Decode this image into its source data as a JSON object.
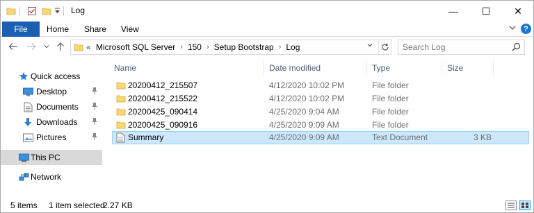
{
  "window": {
    "title": "Log",
    "controls": {
      "minimize": "—",
      "maximize": "☐",
      "close": "✕"
    }
  },
  "ribbon": {
    "tabs": [
      {
        "label": "File"
      },
      {
        "label": "Home"
      },
      {
        "label": "Share"
      },
      {
        "label": "View"
      }
    ]
  },
  "address": {
    "prefix": "«",
    "crumbs": [
      "Microsoft SQL Server",
      "150",
      "Setup Bootstrap",
      "Log"
    ]
  },
  "search": {
    "placeholder": "Search Log"
  },
  "sidebar": {
    "items": [
      {
        "label": "Quick access",
        "icon": "star-icon",
        "pinned": false
      },
      {
        "label": "Desktop",
        "icon": "desktop-icon",
        "pinned": true
      },
      {
        "label": "Documents",
        "icon": "documents-icon",
        "pinned": true
      },
      {
        "label": "Downloads",
        "icon": "download-icon",
        "pinned": true
      },
      {
        "label": "Pictures",
        "icon": "pictures-icon",
        "pinned": true
      },
      {
        "label": "This PC",
        "icon": "computer-icon",
        "pinned": false,
        "selected": true
      },
      {
        "label": "Network",
        "icon": "network-icon",
        "pinned": false
      }
    ]
  },
  "table": {
    "columns": [
      "Name",
      "Date modified",
      "Type",
      "Size"
    ],
    "rows": [
      {
        "name": "20200412_215507",
        "date": "4/12/2020 10:02 PM",
        "type": "File folder",
        "size": "",
        "icon": "folder-icon"
      },
      {
        "name": "20200412_215522",
        "date": "4/12/2020 10:02 PM",
        "type": "File folder",
        "size": "",
        "icon": "folder-icon"
      },
      {
        "name": "20200425_090414",
        "date": "4/25/2020 9:04 AM",
        "type": "File folder",
        "size": "",
        "icon": "folder-icon"
      },
      {
        "name": "20200425_090916",
        "date": "4/25/2020 9:09 AM",
        "type": "File folder",
        "size": "",
        "icon": "folder-icon"
      },
      {
        "name": "Summary",
        "date": "4/25/2020 9:09 AM",
        "type": "Text Document",
        "size": "3 KB",
        "icon": "text-file-icon",
        "selected": true
      }
    ]
  },
  "status": {
    "item_count": "5 items",
    "selected": "1 item selected",
    "selected_size": "2.27 KB"
  },
  "colors": {
    "accent": "#1a5fb4",
    "selection": "#cce8ff",
    "folder": "#f8d775"
  }
}
